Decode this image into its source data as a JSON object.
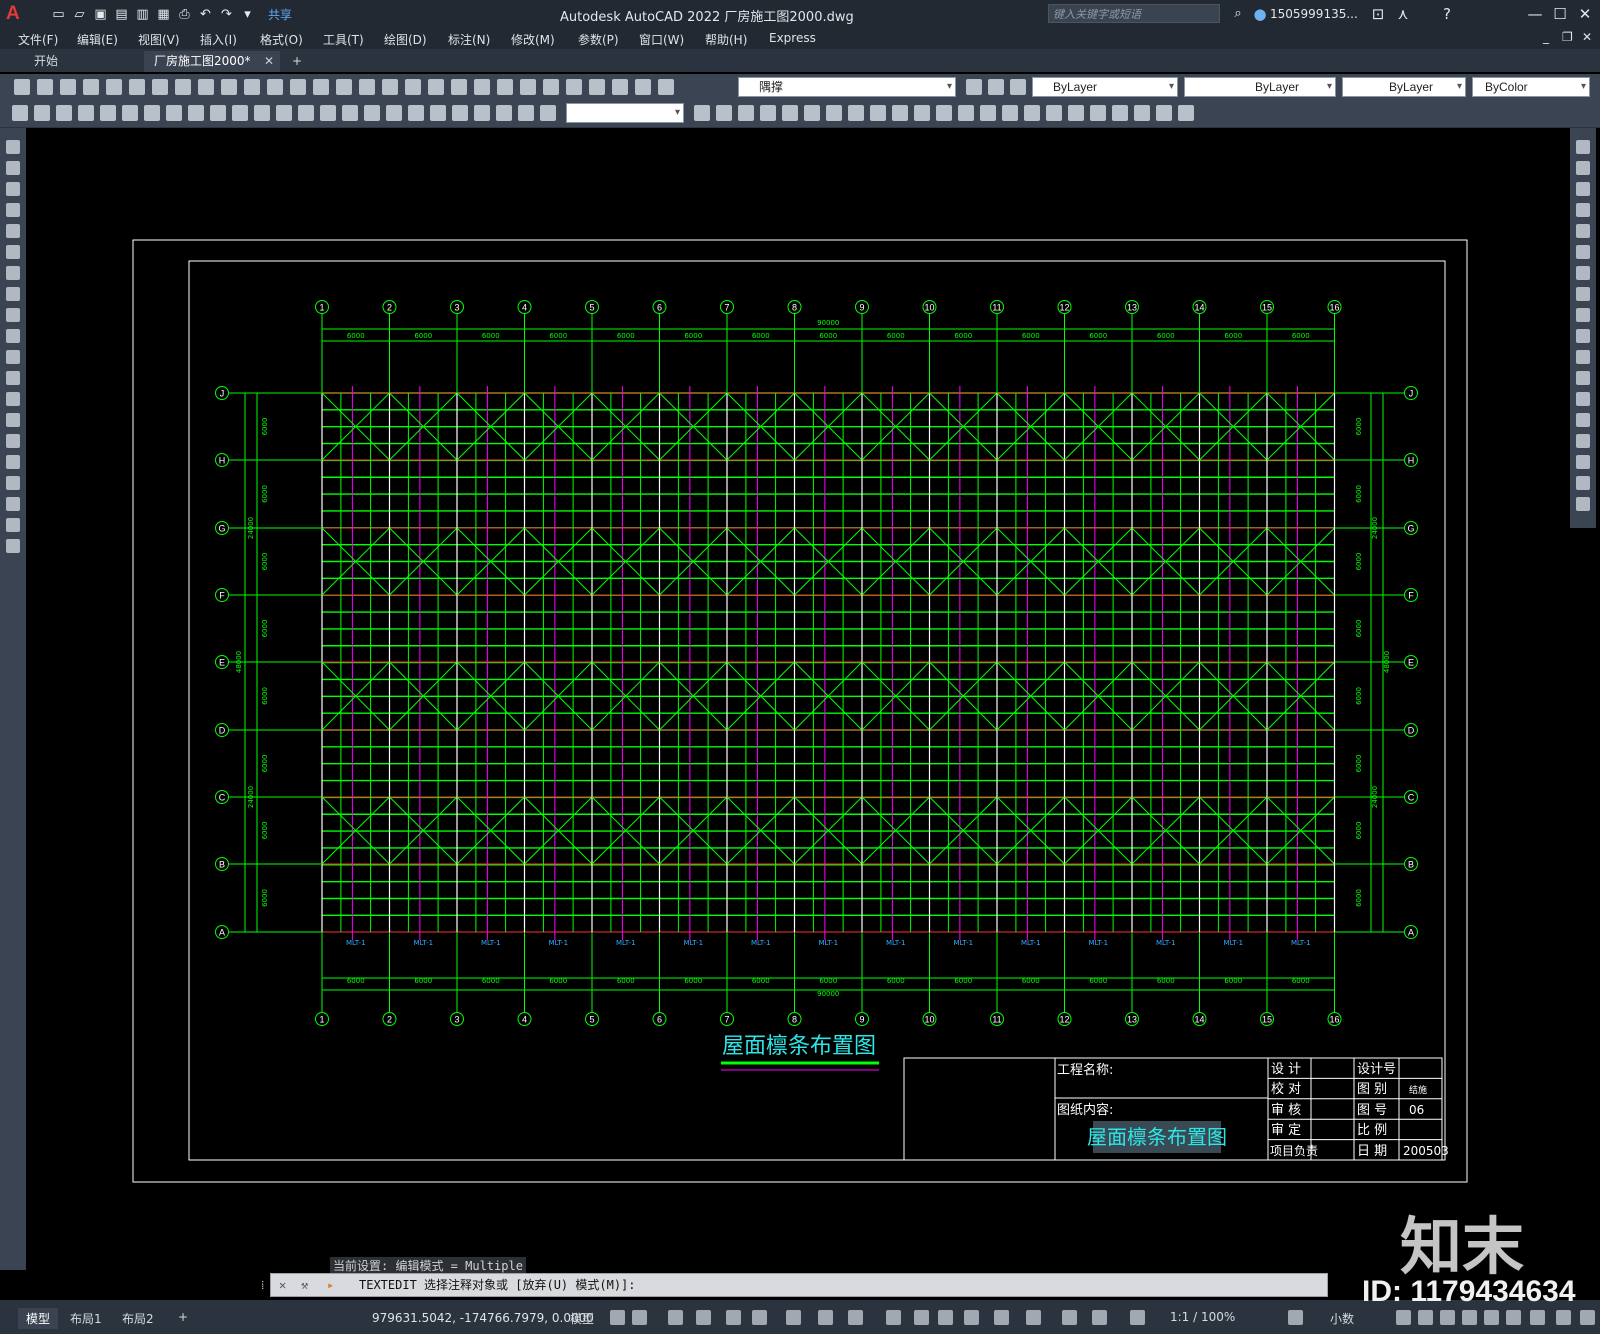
{
  "titlebar": {
    "share_label": "共享",
    "window_title": "Autodesk AutoCAD 2022    厂房施工图2000.dwg",
    "search_placeholder": "键入关键字或短语",
    "user_name": "1505999135..."
  },
  "menu": [
    "文件(F)",
    "编辑(E)",
    "视图(V)",
    "插入(I)",
    "格式(O)",
    "工具(T)",
    "绘图(D)",
    "标注(N)",
    "修改(M)",
    "参数(P)",
    "窗口(W)",
    "帮助(H)",
    "Express"
  ],
  "tabs": {
    "start": "开始",
    "doc": "厂房施工图2000*",
    "new": "+"
  },
  "properties": {
    "layer": "隅撑",
    "color": "ByLayer",
    "linetype": "ByLayer",
    "lineweight": "ByLayer",
    "plotstyle": "ByColor"
  },
  "drawing": {
    "col_labels": [
      "1",
      "2",
      "3",
      "4",
      "5",
      "6",
      "7",
      "8",
      "9",
      "10",
      "11",
      "12",
      "13",
      "14",
      "15",
      "16"
    ],
    "row_labels": [
      "J",
      "H",
      "G",
      "F",
      "E",
      "D",
      "C",
      "B",
      "A"
    ],
    "bay_dim": "6000",
    "total_dim": "90000",
    "row_dim": "6000",
    "half_dim": "24000",
    "full_dim": "48000",
    "beam_tag": "MLT-1",
    "drawing_title": "屋面檩条布置图"
  },
  "titleblock": {
    "project_name_label": "工程名称:",
    "content_label": "图纸内容:",
    "content_value": "屋面檩条布置图",
    "design": "设  计",
    "check": "校  对",
    "review": "审  核",
    "approve": "审  定",
    "project_lead": "项目负责",
    "design_no": "设计号",
    "category": "图  别",
    "category_value": "结施",
    "sheet_no_label": "图  号",
    "sheet_no": "06",
    "scale": "比  例",
    "date": "日  期",
    "date_value": "200503"
  },
  "command": {
    "settings": "当前设置: 编辑模式 = Multiple",
    "prompt": "TEXTEDIT 选择注释对象或 [放弃(U) 模式(M)]:"
  },
  "status": {
    "model_tab": "模型",
    "layout1": "布局1",
    "layout2": "布局2",
    "add": "+",
    "coords": "979631.5042, -174766.7979, 0.0000",
    "model_label": "模型",
    "scale": "1:1 / 100%",
    "units": "小数"
  },
  "watermark": {
    "logo": "知末",
    "id": "ID: 1179434634"
  },
  "colors": {
    "grid": "#00ff00",
    "axis_circle": "#00ff00",
    "title_text": "#2ee6e6",
    "magenta": "#ff00ff",
    "red": "#ff3030",
    "accent": "#5aa9f0"
  }
}
